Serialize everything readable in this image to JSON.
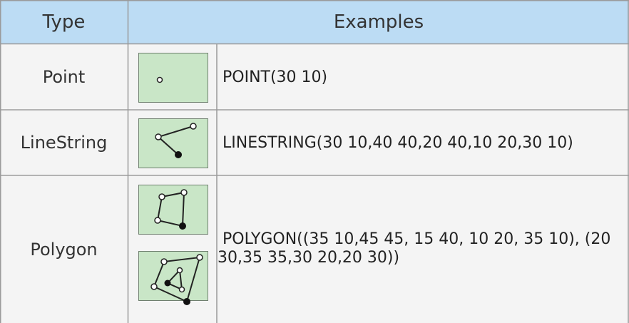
{
  "header": {
    "type_label": "Type",
    "examples_label": "Examples"
  },
  "rows": [
    {
      "type": "Point",
      "wkt": "POINT(30 10)",
      "icon": "point-icon"
    },
    {
      "type": "LineString",
      "wkt": "LINESTRING(30 10,40 40,20 40,10 20,30 10)",
      "icon": "linestring-icon"
    },
    {
      "type": "Polygon",
      "wkt": "POLYGON((35 10,45 45, 15 40, 10 20, 35 10),   (20 30,35 35,30 20,20 30))",
      "icons": [
        "polygon-icon",
        "polygon-with-hole-icon"
      ]
    }
  ],
  "colors": {
    "header_bg": "#bcdcf4",
    "thumb_bg": "#c9e6c7",
    "cell_bg": "#f4f4f4",
    "border": "#9a9a9a"
  }
}
